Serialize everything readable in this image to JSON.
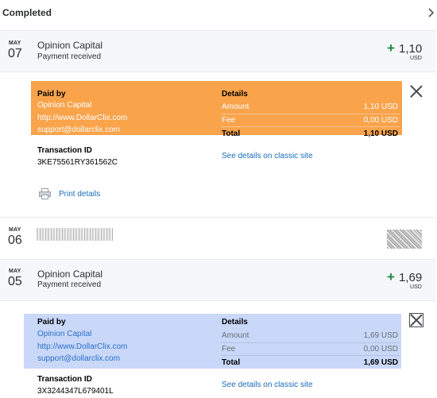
{
  "header": {
    "title": "Completed"
  },
  "transactions": [
    {
      "month": "MAY",
      "day": "07",
      "merchant": "Opinion Capital",
      "status": "Payment received",
      "sign": "+",
      "amount": "1,10",
      "currency": "USD",
      "details": {
        "paid_by_label": "Paid by",
        "paid_by": [
          "Opinion Capital",
          "http://www.DollarClix.com",
          "support@dollarclix.com"
        ],
        "details_label": "Details",
        "rows": [
          {
            "label": "Amount",
            "value": "1,10 USD"
          },
          {
            "label": "Fee",
            "value": "0,00 USD"
          },
          {
            "label": "Total",
            "value": "1,10 USD"
          }
        ],
        "transaction_id_label": "Transaction ID",
        "transaction_id": "3KE75561RY361562C",
        "classic_link": "See details on classic site",
        "print_label": "Print details"
      }
    },
    {
      "month": "MAY",
      "day": "06"
    },
    {
      "month": "MAY",
      "day": "05",
      "merchant": "Opinion Capital",
      "status": "Payment received",
      "sign": "+",
      "amount": "1,69",
      "currency": "USD",
      "details": {
        "paid_by_label": "Paid by",
        "paid_by": [
          "Opinion Capital",
          "http://www.DollarClix.com",
          "support@dollarclix.com"
        ],
        "details_label": "Details",
        "rows": [
          {
            "label": "Amount",
            "value": "1,69 USD"
          },
          {
            "label": "Fee",
            "value": "0,00 USD"
          },
          {
            "label": "Total",
            "value": "1,69 USD"
          }
        ],
        "transaction_id_label": "Transaction ID",
        "transaction_id": "3X3244347L679401L",
        "classic_link": "See details on classic site"
      }
    }
  ],
  "colors": {
    "highlight_orange": "#f9a34b",
    "highlight_blue": "#c9d8f8",
    "positive_green": "#1f8a45",
    "link_blue": "#1a6dbb"
  },
  "icons": [
    "chevron-right-icon",
    "close-icon",
    "printer-icon"
  ]
}
